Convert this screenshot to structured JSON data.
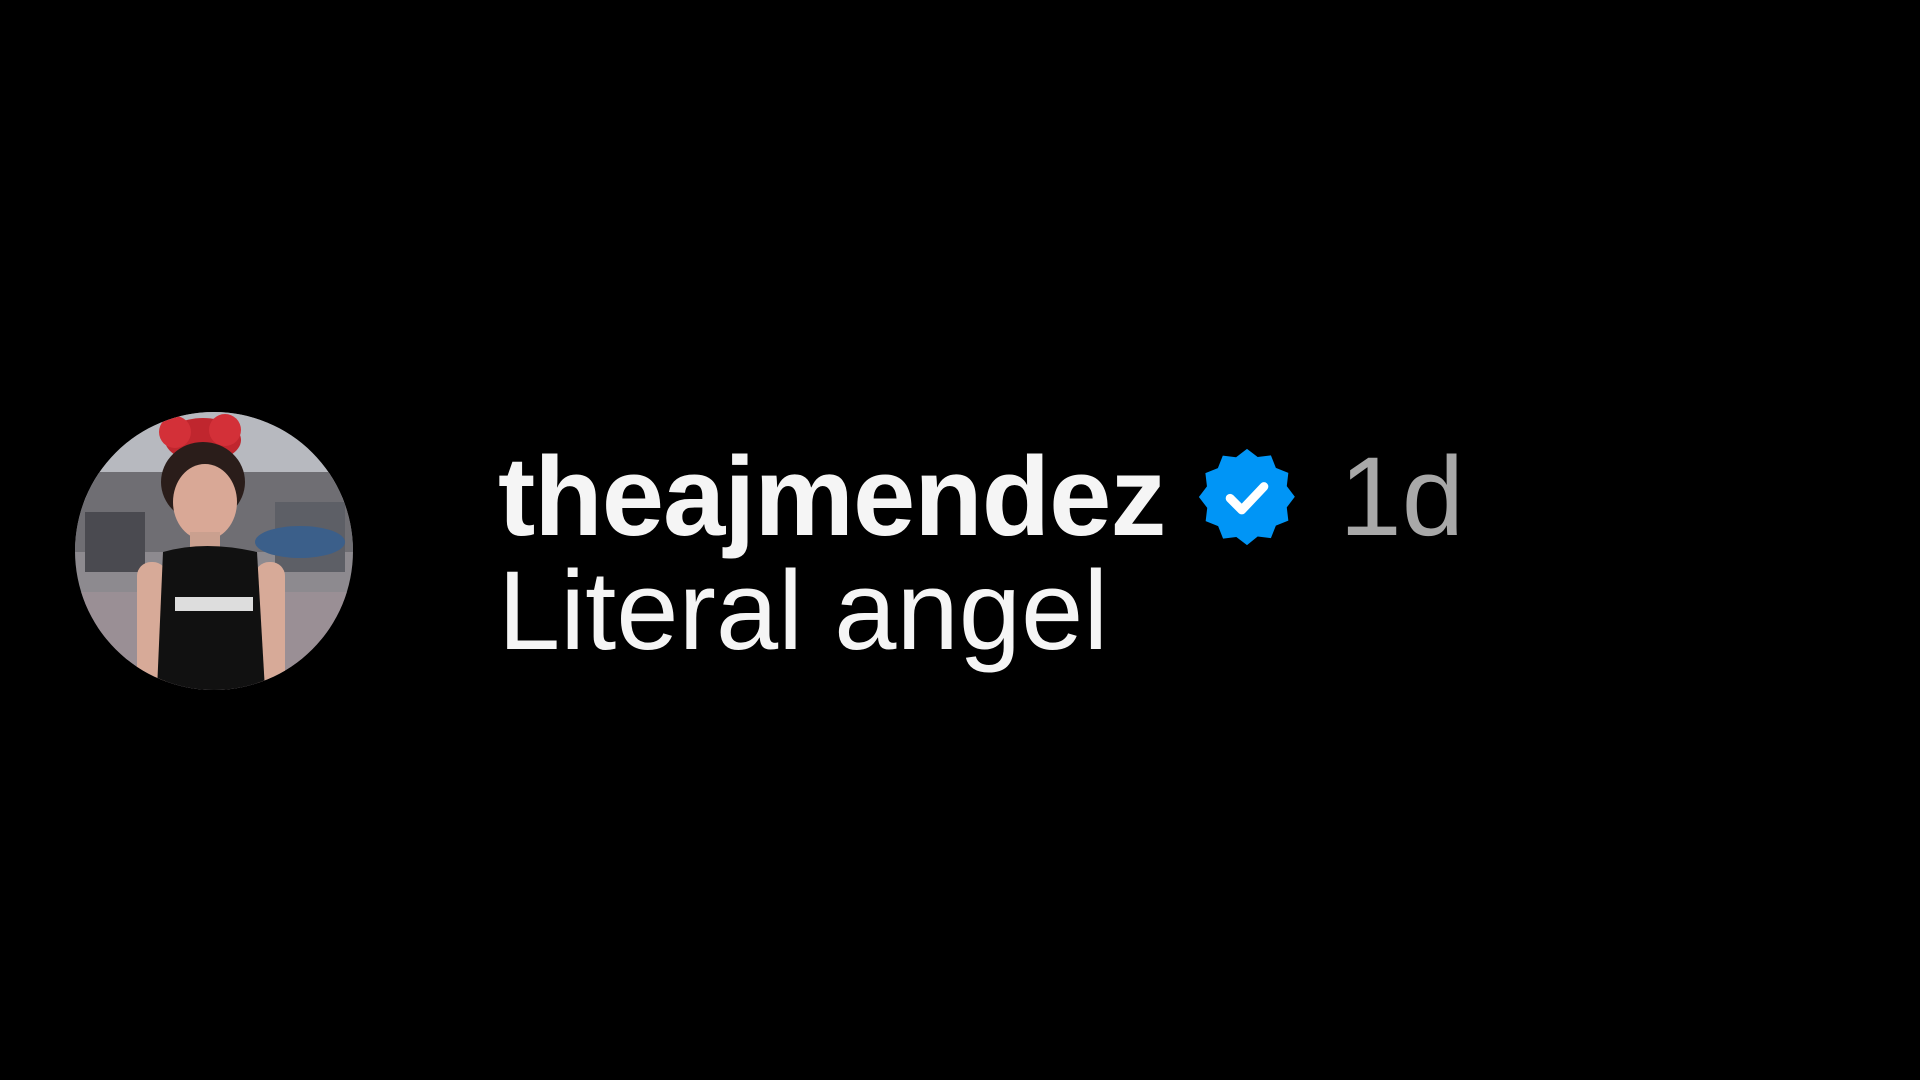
{
  "comment": {
    "username": "theajmendez",
    "verified_icon": "verified-badge-icon",
    "timestamp": "1d",
    "text": "Literal angel",
    "avatar_icon": "profile-photo-avatar"
  },
  "colors": {
    "background": "#000000",
    "primary_text": "#f5f5f5",
    "secondary_text": "#a8a8a8",
    "verified_blue": "#0095f6"
  }
}
